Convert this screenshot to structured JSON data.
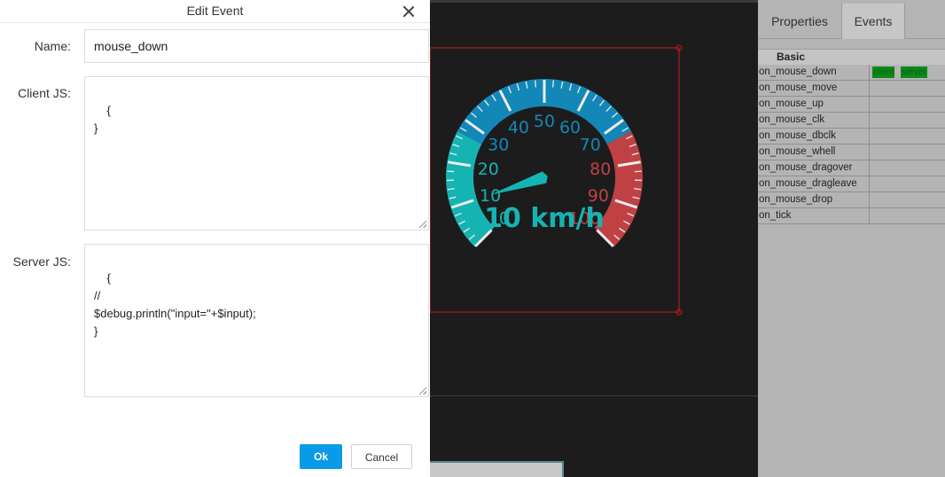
{
  "dialog": {
    "title": "Edit Event",
    "name_label": "Name:",
    "name_value": "mouse_down",
    "client_label": "Client JS:",
    "client_code": "{\n}",
    "server_label": "Server JS:",
    "server_code": "{\n//\n$debug.println(\"input=\"+$input);\n}",
    "ok_label": "Ok",
    "cancel_label": "Cancel"
  },
  "gauge": {
    "value": 10,
    "unit": "km/h",
    "readout": "10 km/h",
    "min": 0,
    "max": 100,
    "tick_labels": [
      "0",
      "10",
      "20",
      "30",
      "40",
      "50",
      "60",
      "70",
      "80",
      "90",
      "100"
    ],
    "colors": {
      "teal": "#16b3b3",
      "blue": "#1387b8",
      "red": "#bf4144",
      "frame": "#cc1a1a"
    }
  },
  "panel": {
    "tabs": [
      {
        "label": "Properties"
      },
      {
        "label": "Events"
      }
    ],
    "group": "Basic",
    "events": [
      {
        "name": "on_mouse_down",
        "client": "client",
        "server": "server"
      },
      {
        "name": "on_mouse_move"
      },
      {
        "name": "on_mouse_up"
      },
      {
        "name": "on_mouse_clk"
      },
      {
        "name": "on_mouse_dbclk"
      },
      {
        "name": "on_mouse_whell"
      },
      {
        "name": "on_mouse_dragover"
      },
      {
        "name": "on_mouse_dragleave"
      },
      {
        "name": "on_mouse_drop"
      },
      {
        "name": "on_tick"
      }
    ]
  }
}
